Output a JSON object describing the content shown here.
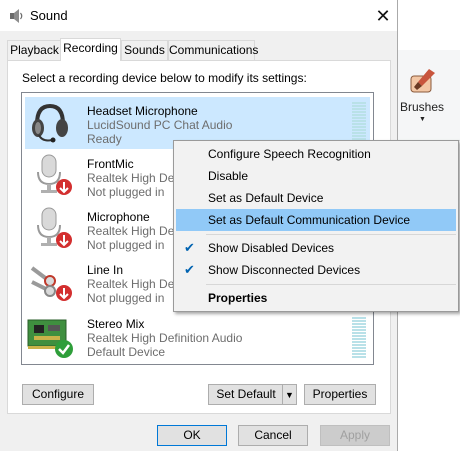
{
  "window": {
    "title": "Sound",
    "close_glyph": "✕"
  },
  "tabs": [
    {
      "label": "Playback"
    },
    {
      "label": "Recording",
      "active": true
    },
    {
      "label": "Sounds"
    },
    {
      "label": "Communications"
    }
  ],
  "instruction": "Select a recording device below to modify its settings:",
  "devices": [
    {
      "name": "Headset Microphone",
      "driver": "LucidSound PC Chat Audio",
      "status": "Ready",
      "selected": true,
      "icon": "headset-icon"
    },
    {
      "name": "FrontMic",
      "driver": "Realtek High Def",
      "status": "Not plugged in",
      "icon": "microphone-unplugged-icon"
    },
    {
      "name": "Microphone",
      "driver": "Realtek High Def",
      "status": "Not plugged in",
      "icon": "microphone-unplugged-icon"
    },
    {
      "name": "Line In",
      "driver": "Realtek High Def",
      "status": "Not plugged in",
      "icon": "line-in-unplugged-icon"
    },
    {
      "name": "Stereo Mix",
      "driver": "Realtek High Definition Audio",
      "status": "Default Device",
      "icon": "sound-card-default-icon"
    }
  ],
  "context_menu": {
    "items": [
      {
        "label": "Configure Speech Recognition"
      },
      {
        "label": "Disable"
      },
      {
        "label": "Set as Default Device"
      },
      {
        "label": "Set as Default Communication Device",
        "highlighted": true
      },
      {
        "label": "Show Disabled Devices",
        "checked": true
      },
      {
        "label": "Show Disconnected Devices",
        "checked": true
      },
      {
        "label": "Properties",
        "bold": true
      }
    ]
  },
  "buttons": {
    "configure": "Configure",
    "set_default": "Set Default",
    "properties": "Properties",
    "ok": "OK",
    "cancel": "Cancel",
    "apply": "Apply"
  },
  "background_app": {
    "tool_label": "Brushes"
  },
  "colors": {
    "selection": "#cce8ff",
    "menu_highlight": "#91c9f7",
    "check": "#0063b1",
    "accent": "#0078d7"
  }
}
